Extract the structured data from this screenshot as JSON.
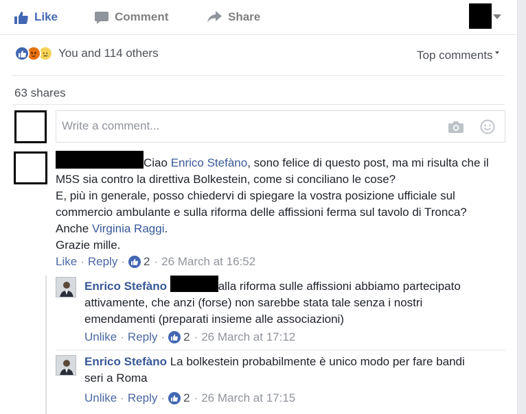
{
  "actions": {
    "like": "Like",
    "comment": "Comment",
    "share": "Share"
  },
  "reactions": {
    "summary": "You and 114 others",
    "icons": [
      "like-reaction-icon",
      "angry-reaction-icon",
      "sad-reaction-icon"
    ]
  },
  "sort": {
    "label": "Top comments"
  },
  "shares": {
    "label": "63 shares"
  },
  "composer": {
    "placeholder": "Write a comment..."
  },
  "comments": [
    {
      "text_prefix": "Ciao ",
      "mention1": "Enrico Stefàno",
      "text_mid": ", sono felice di questo post, ma mi risulta che il M5S sia contro la direttiva Bolkestein, come si conciliano le cose?",
      "line3": "E, più in generale, posso chiedervi di spiegare la vostra posizione ufficiale sul commercio ambulante e sulla riforma delle affissioni ferma sul tavolo di Tronca?",
      "anche": "Anche ",
      "mention2": "Virginia Raggi",
      "period": ".",
      "thanks": "Grazie mille.",
      "like_label": "Like",
      "reply_label": "Reply",
      "reaction_count": "2",
      "timestamp": "26 March at 16:52"
    }
  ],
  "replies": [
    {
      "author": "Enrico Stefàno",
      "text": "alla riforma sulle affissioni abbiamo partecipato attivamente, che anzi (forse) non sarebbe stata tale senza i nostri emendamenti (preparati insieme alle associazioni)",
      "like_label": "Unlike",
      "reply_label": "Reply",
      "reaction_count": "2",
      "timestamp": "26 March at 17:12"
    },
    {
      "author": "Enrico Stefàno",
      "text": "La bolkestein probabilmente è unico modo per fare bandi seri a Roma",
      "like_label": "Unlike",
      "reply_label": "Reply",
      "reaction_count": "2",
      "timestamp": "26 March at 17:15"
    }
  ],
  "colors": {
    "link": "#385898",
    "brand": "#4267b2",
    "muted": "#90949c"
  }
}
